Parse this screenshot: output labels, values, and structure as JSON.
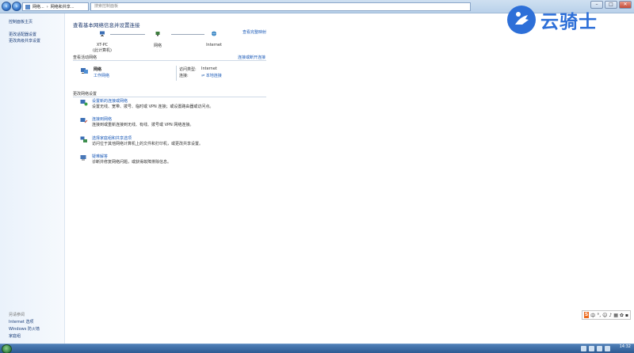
{
  "address_bar": {
    "crumbs": [
      "网络...",
      "网络和共享..."
    ],
    "search_placeholder": "搜索控制面板"
  },
  "left_pane": {
    "links": [
      "控制面板主页",
      "更改适配器设置",
      "更改高级共享设置"
    ],
    "see_also_heading": "另请参阅",
    "see_also": [
      "Internet 选项",
      "Windows 防火墙",
      "家庭组"
    ]
  },
  "main": {
    "title": "查看基本网络信息并设置连接",
    "see_full_map": "查看完整映射",
    "map": {
      "nodes": [
        {
          "label": "XT-PC",
          "sublabel": "(此计算机)"
        },
        {
          "label": "网络",
          "sublabel": ""
        },
        {
          "label": "Internet",
          "sublabel": ""
        }
      ]
    },
    "active_networks": {
      "label": "查看活动网络",
      "action": "连接或断开连接",
      "name": "网络",
      "type": "工作网络",
      "access_type_label": "访问类型:",
      "access_type_value": "Internet",
      "connections_label": "连接:",
      "connections_value": "本地连接"
    },
    "change_settings": {
      "label": "更改网络设置",
      "tasks": [
        {
          "link": "设置新的连接或网络",
          "desc": "设置无线、宽带、拨号、临时或 VPN 连接；或设置路由器或访问点。",
          "icon": "new-connection-icon"
        },
        {
          "link": "连接到网络",
          "desc": "连接到或重新连接到无线、有线、拨号或 VPN 网络连接。",
          "icon": "connect-network-icon"
        },
        {
          "link": "选择家庭组和共享选项",
          "desc": "访问位于其他网络计算机上的文件和打印机，或更改共享设置。",
          "icon": "homegroup-icon"
        },
        {
          "link": "疑难解答",
          "desc": "诊断并修复网络问题，或获得故障排除信息。",
          "icon": "troubleshoot-icon"
        }
      ]
    }
  },
  "watermark": {
    "text": "云骑士"
  },
  "ime": {
    "logo": "S",
    "mode": "中"
  },
  "taskbar": {
    "time": "14:32",
    "date": ""
  },
  "colors": {
    "link": "#1c5bb8",
    "title": "#1e3a6e",
    "taskbar": "#2d5a92",
    "watermark": "#2d6fd8"
  }
}
